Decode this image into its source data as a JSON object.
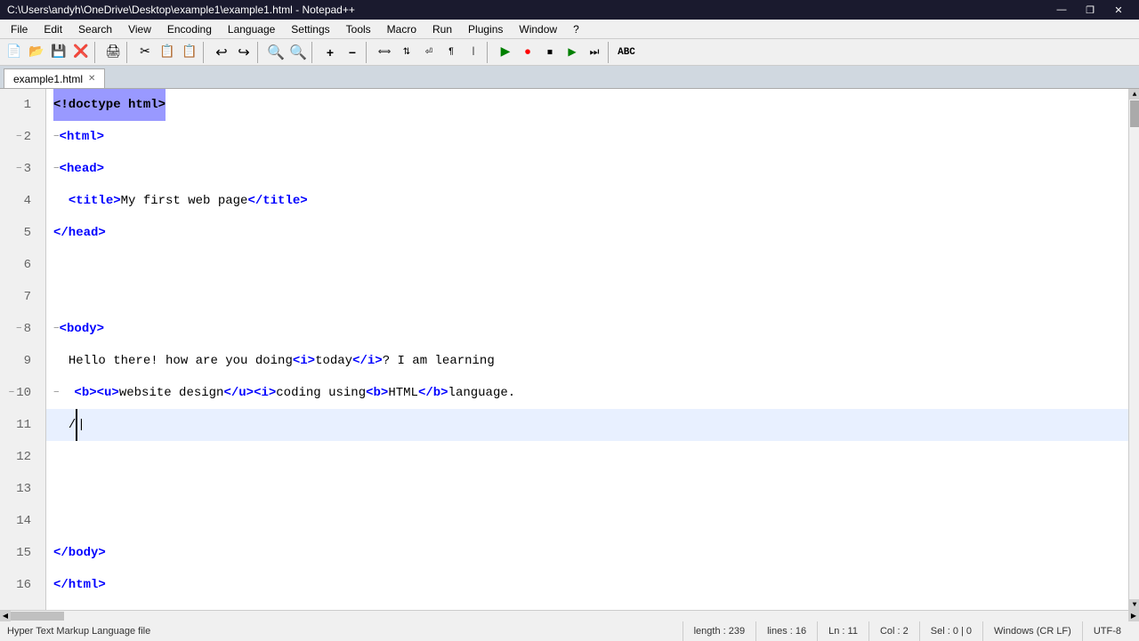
{
  "title_bar": {
    "text": "C:\\Users\\andyh\\OneDrive\\Desktop\\example1\\example1.html - Notepad++",
    "minimize": "—",
    "maximize": "❐",
    "close": "✕"
  },
  "menu": {
    "items": [
      "File",
      "Edit",
      "Search",
      "View",
      "Encoding",
      "Language",
      "Settings",
      "Tools",
      "Macro",
      "Run",
      "Plugins",
      "Window",
      "?"
    ]
  },
  "tab": {
    "label": "example1.html",
    "close": "✕"
  },
  "lines": [
    {
      "num": "1",
      "active": false,
      "fold": "",
      "content_html": "<span class='tag'>&lt;!doctype html&gt;</span>",
      "highlight": true
    },
    {
      "num": "2",
      "active": false,
      "fold": "⊖",
      "content_html": "<span class='tag'>&lt;html&gt;</span>"
    },
    {
      "num": "3",
      "active": false,
      "fold": "⊖",
      "content_html": "<span class='tag'>&lt;head&gt;</span>"
    },
    {
      "num": "4",
      "active": false,
      "fold": "",
      "content_html": "&nbsp;&nbsp;<span class='tag'>&lt;title&gt;</span><span class='text-content'>My first web page</span><span class='tag'>&lt;/title&gt;</span>"
    },
    {
      "num": "5",
      "active": false,
      "fold": "",
      "content_html": "<span class='tag'>&lt;/head&gt;</span>"
    },
    {
      "num": "6",
      "active": false,
      "fold": "",
      "content_html": ""
    },
    {
      "num": "7",
      "active": false,
      "fold": "",
      "content_html": ""
    },
    {
      "num": "8",
      "active": false,
      "fold": "⊖",
      "content_html": "<span class='tag'>&lt;body&gt;</span>"
    },
    {
      "num": "9",
      "active": false,
      "fold": "",
      "content_html": "&nbsp;&nbsp;<span class='text-content'>Hello there! how are you doing </span><span class='tag'>&lt;i&gt;</span><span class='text-content'>today</span><span class='tag'>&lt;/i&gt;</span><span class='text-content'>? I am learning</span>"
    },
    {
      "num": "10",
      "active": false,
      "fold": "⊖",
      "content_html": "&nbsp;&nbsp;<span class='tag'>&lt;b&gt;&lt;u&gt;</span><span class='text-content'>website design</span><span class='tag'>&lt;/u&gt;&lt;i&gt;</span><span class='text-content'> coding using </span><span class='tag'>&lt;b&gt;</span><span class='text-content'>HTML</span><span class='tag'>&lt;/b&gt;</span><span class='text-content'> language.</span>"
    },
    {
      "num": "11",
      "active": true,
      "fold": "",
      "content_html": "&nbsp;&nbsp;<span class='text-content'>/</span><span class='cursor'>|</span>"
    },
    {
      "num": "12",
      "active": false,
      "fold": "",
      "content_html": ""
    },
    {
      "num": "13",
      "active": false,
      "fold": "",
      "content_html": ""
    },
    {
      "num": "14",
      "active": false,
      "fold": "",
      "content_html": ""
    },
    {
      "num": "15",
      "active": false,
      "fold": "",
      "content_html": "<span class='tag'>&lt;/body&gt;</span>"
    },
    {
      "num": "16",
      "active": false,
      "fold": "",
      "content_html": "<span class='tag'>&lt;/html&gt;</span>"
    }
  ],
  "status": {
    "file_type": "Hyper Text Markup Language file",
    "length": "length : 239",
    "lines": "lines : 16",
    "ln": "Ln : 11",
    "col": "Col : 2",
    "sel": "Sel : 0 | 0",
    "line_ending": "Windows (CR LF)",
    "encoding": "UTF-8"
  },
  "toolbar_icons": [
    "📄",
    "📂",
    "💾",
    "🖨️",
    "✂️",
    "📋",
    "📋",
    "↩️",
    "↪️",
    "🔍",
    "🔍",
    "🔖",
    "🔖",
    "⟨",
    "⟩",
    "📌",
    "⚙️",
    "🔲",
    "✅",
    "⬛",
    "►",
    "◄",
    "►",
    "⬛",
    "⬛",
    "🔤"
  ]
}
